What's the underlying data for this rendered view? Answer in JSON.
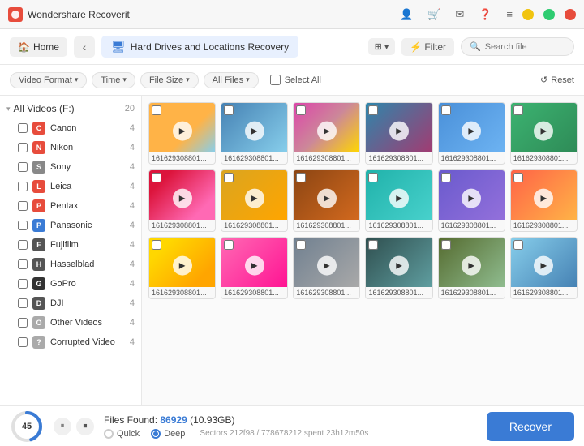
{
  "titleBar": {
    "appName": "Wondershare Recoverit",
    "controls": [
      "minimize",
      "maximize",
      "close"
    ]
  },
  "navBar": {
    "homeLabel": "Home",
    "backArrow": "‹",
    "locationIcon": "💾",
    "locationLabel": "Hard Drives and Locations Recovery",
    "gridIcon": "⊞",
    "filterLabel": "Filter",
    "searchPlaceholder": "Search file",
    "resetLabel": "Reset"
  },
  "filterBar": {
    "filters": [
      "Video Format",
      "Time",
      "File Size",
      "All Files"
    ],
    "selectAllLabel": "Select All"
  },
  "sidebar": {
    "rootLabel": "All Videos (F:)",
    "rootCount": "20",
    "items": [
      {
        "label": "Canon",
        "color": "#e74c3c",
        "count": "4",
        "letter": "C"
      },
      {
        "label": "Nikon",
        "color": "#e74c3c",
        "count": "4",
        "letter": "N"
      },
      {
        "label": "Sony",
        "color": "#888",
        "count": "4",
        "letter": "S"
      },
      {
        "label": "Leica",
        "color": "#e74c3c",
        "count": "4",
        "letter": "L"
      },
      {
        "label": "Pentax",
        "color": "#e74c3c",
        "count": "4",
        "letter": "P"
      },
      {
        "label": "Panasonic",
        "color": "#3a7bd5",
        "count": "4",
        "letter": "P"
      },
      {
        "label": "Fujifilm",
        "color": "#555",
        "count": "4",
        "letter": "F"
      },
      {
        "label": "Hasselblad",
        "color": "#555",
        "count": "4",
        "letter": "H"
      },
      {
        "label": "GoPro",
        "color": "#333",
        "count": "4",
        "letter": "G"
      },
      {
        "label": "DJI",
        "color": "#555",
        "count": "4",
        "letter": "D"
      },
      {
        "label": "Other Videos",
        "color": "#aaa",
        "count": "4",
        "letter": "O"
      },
      {
        "label": "Corrupted Video",
        "color": "#aaa",
        "count": "4",
        "letter": "?"
      }
    ]
  },
  "grid": {
    "thumbLabel": "161629308801...",
    "thumbs": [
      {
        "colorClass": "t2"
      },
      {
        "colorClass": "t3"
      },
      {
        "colorClass": "t4"
      },
      {
        "colorClass": "t5"
      },
      {
        "colorClass": "t6"
      },
      {
        "colorClass": "t7"
      },
      {
        "colorClass": "t8"
      },
      {
        "colorClass": "t9"
      },
      {
        "colorClass": "t10"
      },
      {
        "colorClass": "t11"
      },
      {
        "colorClass": "t12"
      },
      {
        "colorClass": "t13"
      },
      {
        "colorClass": "t14"
      },
      {
        "colorClass": "t15"
      },
      {
        "colorClass": "t16"
      },
      {
        "colorClass": "t17"
      },
      {
        "colorClass": "t18"
      },
      {
        "colorClass": "t1"
      }
    ]
  },
  "bottomBar": {
    "progressValue": 45,
    "progressText": "45",
    "filesFoundLabel": "Files Found:",
    "filesCount": "86929",
    "fileSize": "(10.93GB)",
    "pauseIcon": "⏸",
    "stopIcon": "⏹",
    "scanModes": [
      {
        "label": "Quick",
        "active": false
      },
      {
        "label": "Deep",
        "active": true
      }
    ],
    "scanInfo": "Sectors 212f98 / 778678212     spent 23h12m50s",
    "recoverLabel": "Recover"
  }
}
